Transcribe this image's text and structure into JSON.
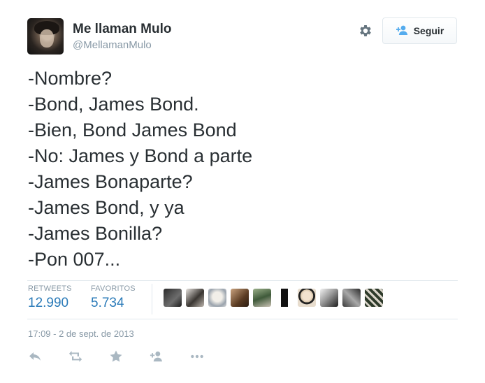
{
  "author": {
    "name": "Me llaman Mulo",
    "handle": "@MellamanMulo"
  },
  "header": {
    "follow_label": "Seguir",
    "settings_icon": "gear-icon",
    "follow_icon": "add-user-icon"
  },
  "tweet": {
    "lines": [
      "-Nombre?",
      "-Bond, James Bond.",
      "-Bien, Bond James Bond",
      "-No: James y Bond a parte",
      "-James Bonaparte?",
      "-James Bond, y ya",
      "-James Bonilla?",
      "-Pon 007..."
    ]
  },
  "stats": {
    "retweets_label": "RETWEETS",
    "retweets_value": "12.990",
    "favorites_label": "FAVORITOS",
    "favorites_value": "5.734",
    "favoriters_shown": 10
  },
  "timestamp": "17:09 - 2 de sept. de 2013",
  "actions": [
    {
      "name": "reply",
      "icon": "reply-icon"
    },
    {
      "name": "retweet",
      "icon": "retweet-icon"
    },
    {
      "name": "favorite",
      "icon": "star-icon"
    },
    {
      "name": "follow",
      "icon": "add-user-icon"
    },
    {
      "name": "more",
      "icon": "more-dots-icon"
    }
  ],
  "colors": {
    "link_blue": "#2b7bb9",
    "muted_gray": "#8899a6",
    "action_gray": "#aab8c2",
    "text": "#292f33"
  }
}
